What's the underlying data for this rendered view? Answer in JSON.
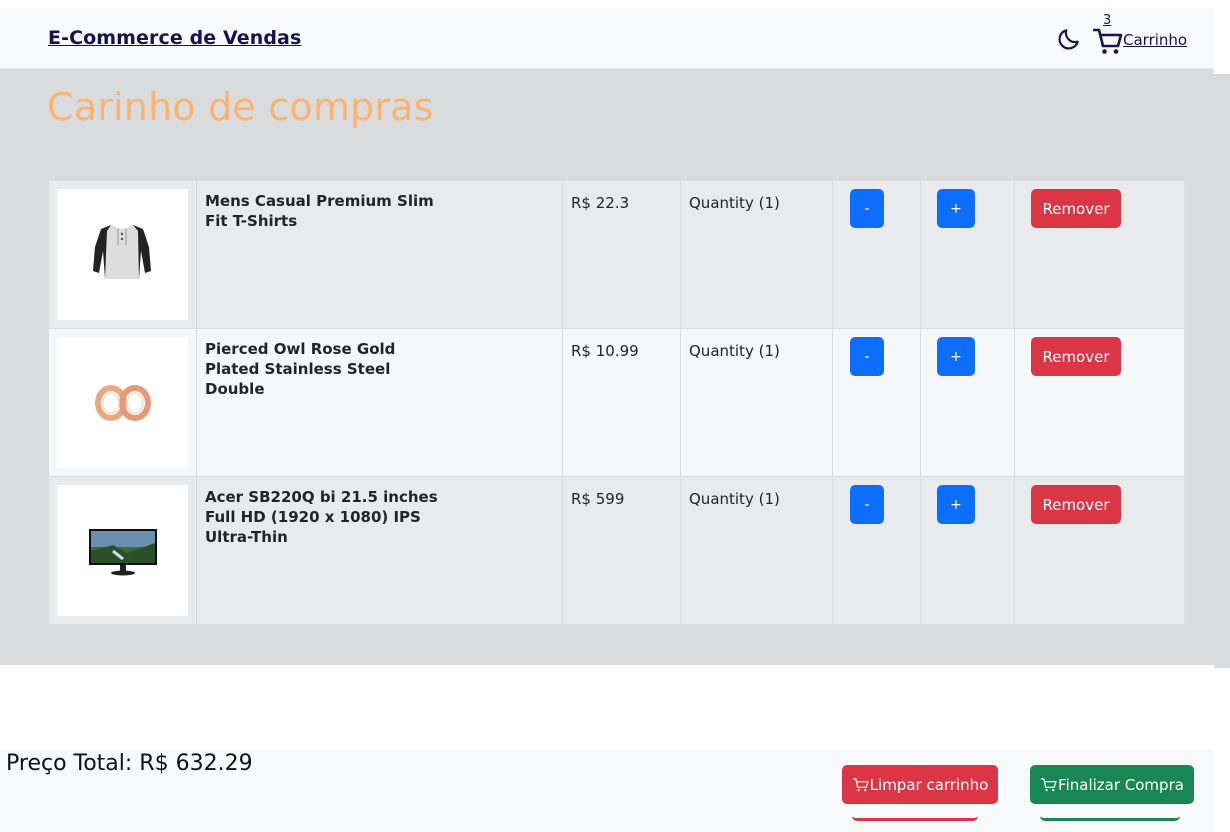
{
  "navbar": {
    "brand": "E-Commerce de Vendas",
    "theme_icon": "moon-icon",
    "cart_count": "3",
    "cart_label": "Carrinho"
  },
  "page": {
    "title": "Carinho de compras"
  },
  "items": [
    {
      "title": "Mens Casual Premium Slim Fit T-Shirts",
      "price": "R$ 22.3",
      "quantity": "Quantity (1)",
      "minus_label": "-",
      "plus_label": "+",
      "remove_label": "Remover",
      "image": "tshirt-image"
    },
    {
      "title": "Pierced Owl Rose Gold Plated Stainless Steel Double",
      "price": "R$ 10.99",
      "quantity": "Quantity (1)",
      "minus_label": "-",
      "plus_label": "+",
      "remove_label": "Remover",
      "image": "rings-image"
    },
    {
      "title": "Acer SB220Q bi 21.5 inches Full HD (1920 x 1080) IPS Ultra-Thin",
      "price": "R$ 599",
      "quantity": "Quantity (1)",
      "minus_label": "-",
      "plus_label": "+",
      "remove_label": "Remover",
      "image": "monitor-image"
    }
  ],
  "footer": {
    "total": "Preço Total: R$ 632.29",
    "clear_label": "Limpar carrinho",
    "checkout_label": "Finalizar Compra"
  },
  "colors": {
    "accent_title": "#fdb36e",
    "primary": "#0d6efd",
    "danger": "#dc3545",
    "success": "#198754",
    "brand": "#1a1150"
  }
}
